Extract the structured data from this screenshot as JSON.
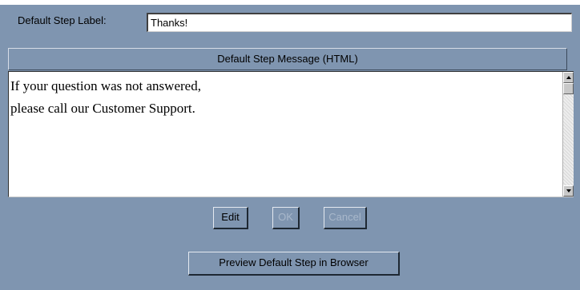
{
  "step_label": {
    "label": "Default Step Label:",
    "value": "Thanks!"
  },
  "message_panel": {
    "header": "Default Step Message (HTML)",
    "content": "If your question was not answered,\nplease call our Customer Support."
  },
  "scrollbar": {
    "up_icon": "arrow-up-icon",
    "down_icon": "arrow-down-icon"
  },
  "buttons": {
    "edit": "Edit",
    "ok": "OK",
    "cancel": "Cancel",
    "preview": "Preview Default Step in Browser"
  },
  "colors": {
    "background": "#7f95b0",
    "disabled_text": "#a9b8cb"
  }
}
